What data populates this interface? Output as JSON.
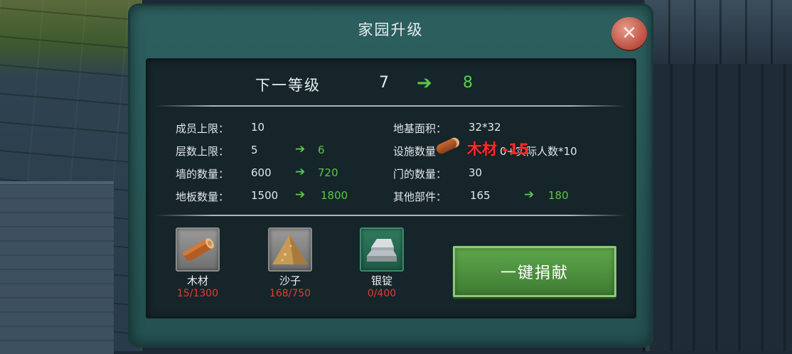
{
  "panel": {
    "title": "家园升级",
    "close_icon": "close-icon"
  },
  "level": {
    "label": "下一等级",
    "from": "7",
    "to": "8",
    "arrow_icon": "green-arrow-icon"
  },
  "stats_left": [
    {
      "label": "成员上限：",
      "value": "10",
      "new": ""
    },
    {
      "label": "层数上限：",
      "value": "5",
      "new": "6"
    },
    {
      "label": "墙的数量：",
      "value": "600",
      "new": "720"
    },
    {
      "label": "地板数量：",
      "value": "1500",
      "new": "1800"
    }
  ],
  "stats_right": [
    {
      "label": "地基面积：",
      "value": "32*32",
      "new": ""
    },
    {
      "label": "设施数量",
      "value": "0+实际人数*10",
      "new": ""
    },
    {
      "label": "门的数量：",
      "value": "30",
      "new": ""
    },
    {
      "label": "其他部件：",
      "value": "165",
      "new": "180"
    }
  ],
  "pickup": {
    "icon": "wood-log-icon",
    "text": "木材 -15"
  },
  "resources": [
    {
      "name": "木材",
      "count": "15/1300",
      "icon": "wood-icon"
    },
    {
      "name": "沙子",
      "count": "168/750",
      "icon": "sand-icon"
    },
    {
      "name": "银锭",
      "count": "0/400",
      "icon": "silver-ingot-icon"
    }
  ],
  "donate_button": "一键捐献",
  "colors": {
    "panel": "#2d5f5f",
    "inner": "#15252a",
    "increase_green": "#59c84a",
    "shortage_red": "#e53a2e",
    "button_green": "#4f9440"
  }
}
